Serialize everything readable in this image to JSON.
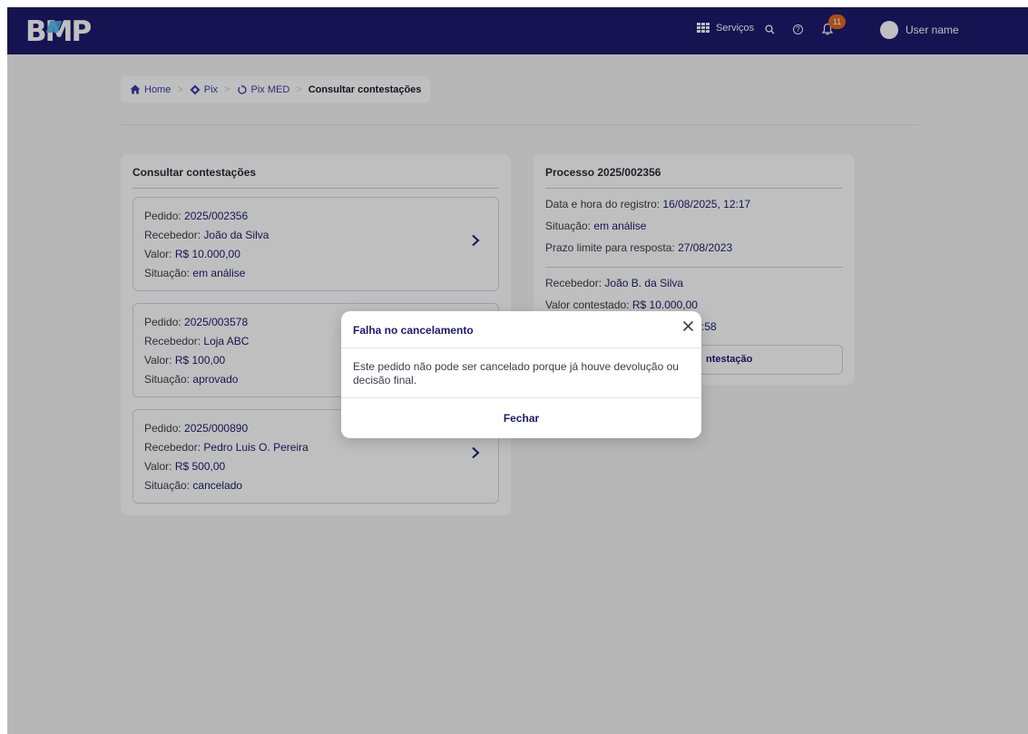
{
  "header": {
    "logo": "BMP",
    "services_label": "Serviços",
    "notifications_count": "11",
    "user_name": "User name",
    "icons": [
      "apps-grid-icon",
      "search-icon",
      "help-icon",
      "bell-icon"
    ]
  },
  "breadcrumb": [
    {
      "label": "Home",
      "icon": "home-icon"
    },
    {
      "label": "Pix",
      "icon": "pix-icon"
    },
    {
      "label": "Pix MED",
      "icon": "refresh-icon"
    },
    {
      "label": "Consultar contestações"
    }
  ],
  "list": {
    "title": "Consultar contestações",
    "field_labels": {
      "pedido": "Pedido:",
      "recebedor": "Recebedor:",
      "valor": "Valor:",
      "situacao": "Situação:"
    },
    "items": [
      {
        "pedido": "2025/002356",
        "recebedor": "João da Silva",
        "valor": "R$ 10.000,00",
        "situacao": "em análise"
      },
      {
        "pedido": "2025/003578",
        "recebedor": "Loja ABC",
        "valor": "R$ 100,00",
        "situacao": "aprovado"
      },
      {
        "pedido": "2025/000890",
        "recebedor": "Pedro Luis O. Pereira",
        "valor": "R$ 500,00",
        "situacao": "cancelado"
      }
    ]
  },
  "detail": {
    "title": "Processo 2025/002356",
    "registro_label": "Data e hora do registro:",
    "registro_value": "16/08/2025, 12:17",
    "situacao_label": "Situação:",
    "situacao_value": "em análise",
    "prazo_label": "Prazo limite para resposta:",
    "prazo_value": "27/08/2023",
    "recebedor_label": "Recebedor:",
    "recebedor_value": "João B. da Silva",
    "valor_label": "Valor contestado:",
    "valor_value": "R$ 10.000,00",
    "partial_line": ":58",
    "button_partial": "ntestação"
  },
  "modal": {
    "title": "Falha no cancelamento",
    "body": "Este pedido não pode ser cancelado porque já houve devolução ou decisão final.",
    "close_button": "Fechar"
  },
  "colors": {
    "navy": "#1c1a6e",
    "badge": "#e0691e",
    "page_background": "#f4f4f6"
  }
}
